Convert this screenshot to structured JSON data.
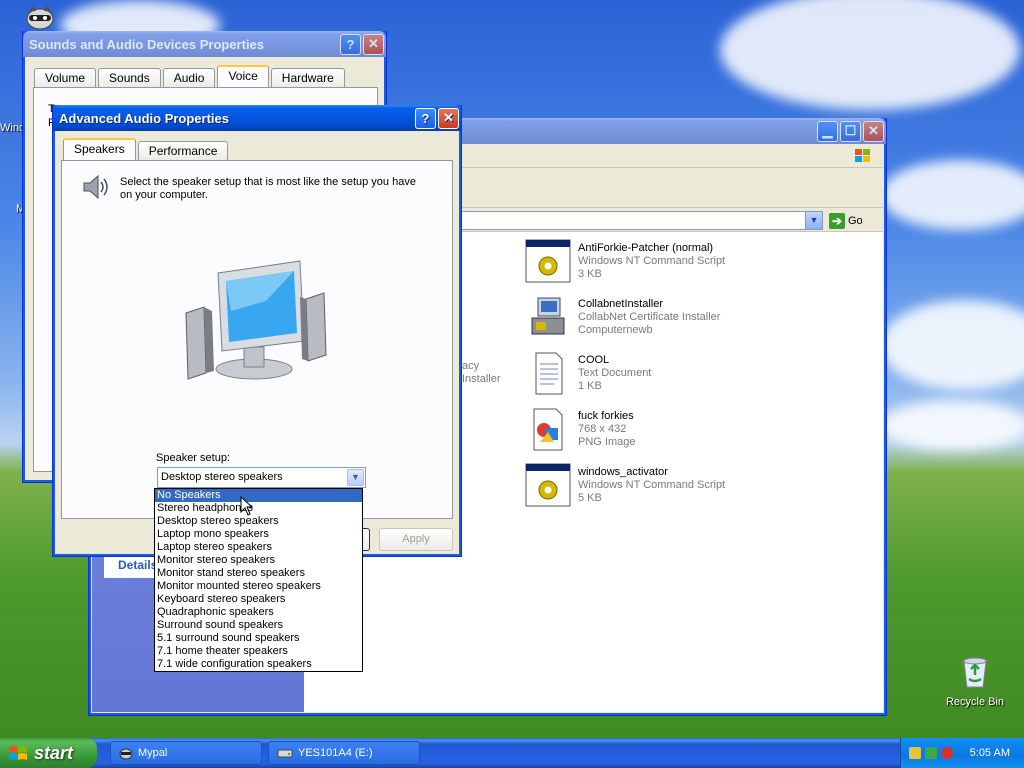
{
  "desktop": {
    "recycle_bin_label": "Recycle Bin"
  },
  "explorer": {
    "title": "",
    "address_go": "Go",
    "side_panel": {
      "details_label": "Details"
    },
    "partial_items": [
      {
        "name": "acy",
        "sub": "Installer"
      }
    ],
    "files": [
      {
        "name": "AntiForkie-Patcher (normal)",
        "type": "Windows NT Command Script",
        "size": "3 KB",
        "icon": "cmd-script-icon"
      },
      {
        "name": "CollabnetInstaller",
        "type": "CollabNet Certificate Installer",
        "size": "Computernewb",
        "icon": "installer-icon"
      },
      {
        "name": "COOL",
        "type": "Text Document",
        "size": "1 KB",
        "icon": "text-document-icon"
      },
      {
        "name": "fuck forkies",
        "type": "768 x 432",
        "size": "PNG Image",
        "icon": "png-image-icon"
      },
      {
        "name": "windows_activator",
        "type": "Windows NT Command Script",
        "size": "5 KB",
        "icon": "cmd-script-icon"
      }
    ]
  },
  "sounds_dialog": {
    "title": "Sounds and Audio Devices Properties",
    "tabs": [
      "Volume",
      "Sounds",
      "Audio",
      "Voice",
      "Hardware"
    ],
    "active_tab": "Voice",
    "partial_text": [
      "T",
      "P"
    ]
  },
  "advanced_dialog": {
    "title": "Advanced Audio Properties",
    "tabs": [
      "Speakers",
      "Performance"
    ],
    "active_tab": "Speakers",
    "instruction": "Select the speaker setup that is most like the setup you have on your computer.",
    "speaker_setup_label": "Speaker setup:",
    "speaker_setup_value": "Desktop stereo speakers",
    "speaker_setup_options": [
      "No Speakers",
      "Stereo headphones",
      "Desktop stereo speakers",
      "Laptop mono speakers",
      "Laptop stereo speakers",
      "Monitor stereo speakers",
      "Monitor stand stereo speakers",
      "Monitor mounted stereo speakers",
      "Keyboard stereo speakers",
      "Quadraphonic speakers",
      "Surround sound speakers",
      "5.1 surround sound speakers",
      "7.1 home theater speakers",
      "7.1 wide configuration speakers"
    ],
    "highlighted_option": "No Speakers",
    "apply_label": "Apply"
  },
  "taskbar": {
    "start_label": "start",
    "tasks": [
      {
        "label": "Mypal",
        "icon": "mypal-browser-icon"
      },
      {
        "label": "YES101A4 (E:)",
        "icon": "drive-icon"
      }
    ],
    "clock": "5:05 AM"
  },
  "left_edge_text": [
    "Windo",
    "M"
  ]
}
